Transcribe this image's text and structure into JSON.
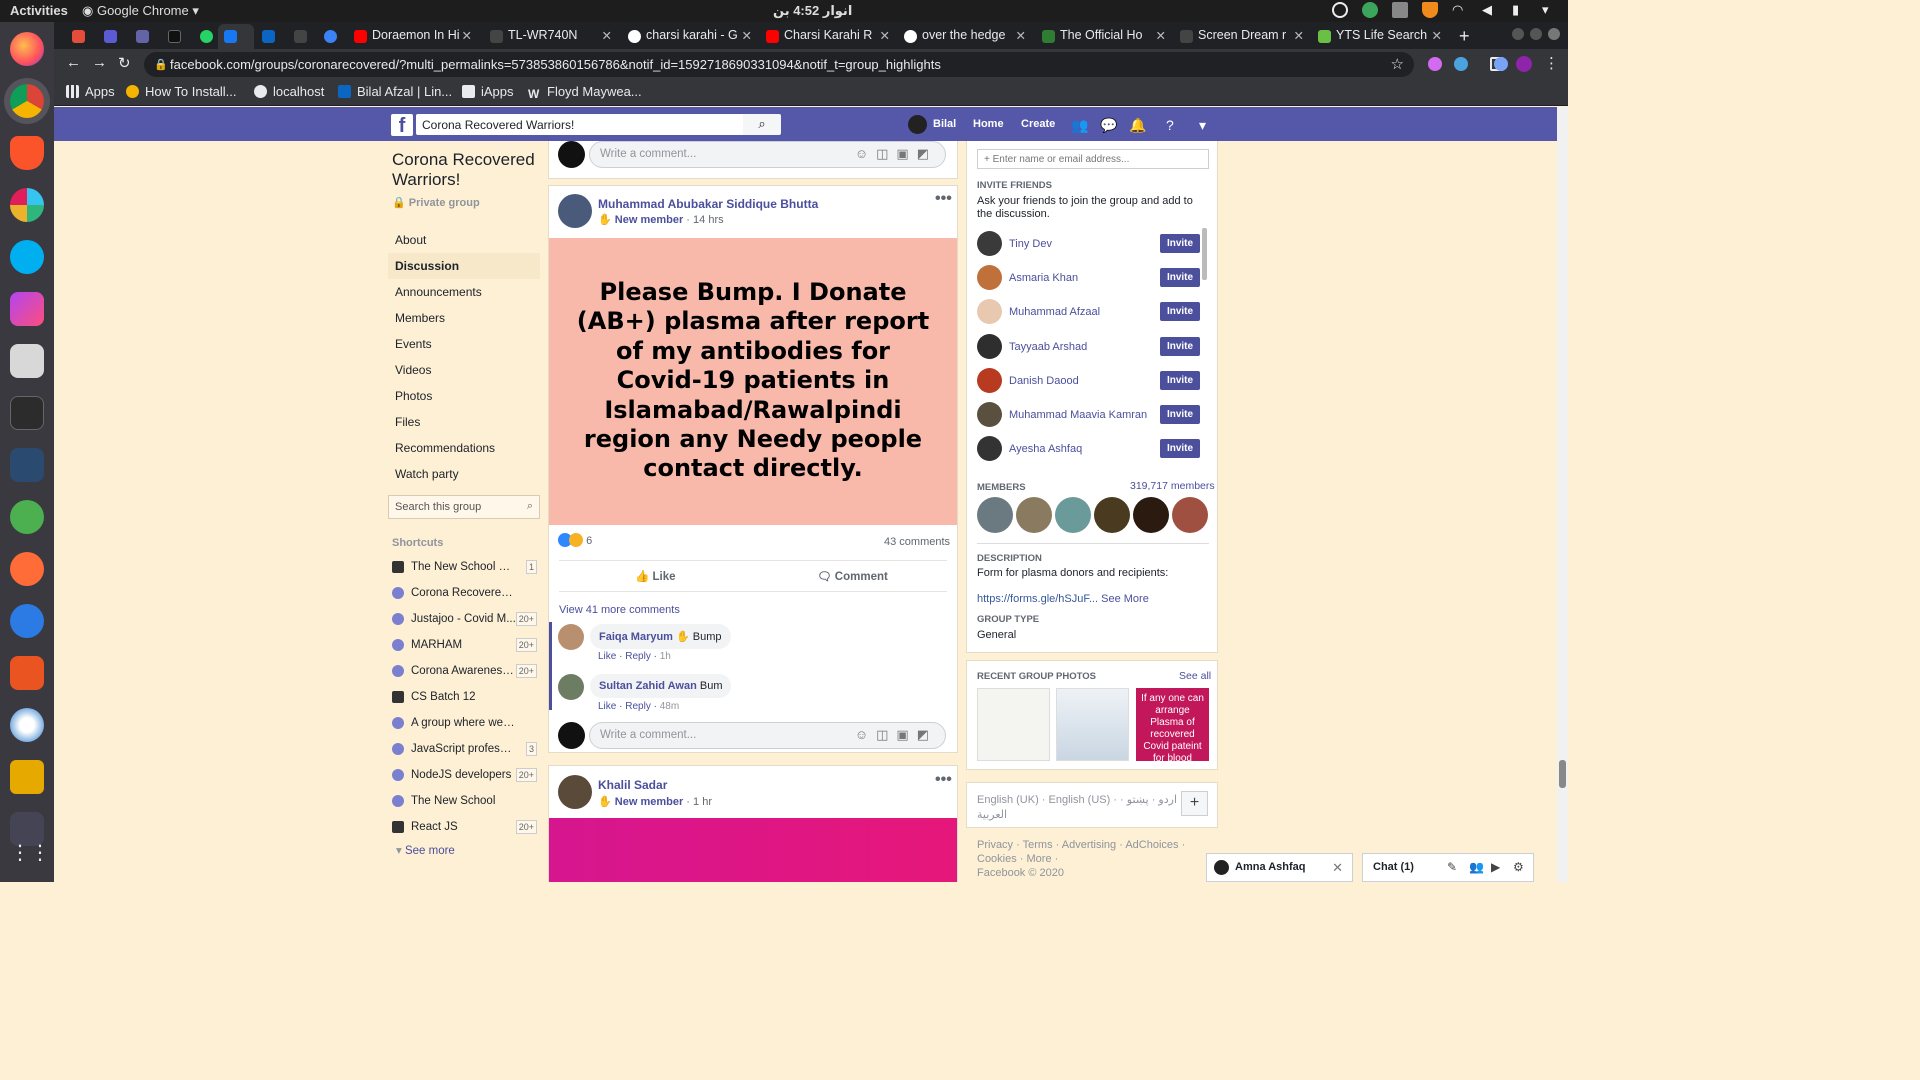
{
  "os": {
    "activities": "Activities",
    "app_menu": "Google Chrome",
    "clock": "انوار 4:52 بن"
  },
  "tabs": [
    {
      "label": "",
      "icon": "gmail-icon",
      "color": "#e44d3a"
    },
    {
      "label": "",
      "icon": "linear-icon",
      "color": "#5b5bd6"
    },
    {
      "label": "",
      "icon": "teams-icon",
      "color": "#6264a7"
    },
    {
      "label": "",
      "icon": "dev-icon",
      "color": "#111111"
    },
    {
      "label": "",
      "icon": "whatsapp-icon",
      "color": "#25d366"
    },
    {
      "label": "",
      "icon": "facebook-icon",
      "color": "#1877f2"
    },
    {
      "label": "",
      "icon": "linkedin-icon",
      "color": "#0a66c2"
    },
    {
      "label": "",
      "icon": "blank-icon",
      "color": "#444444"
    },
    {
      "label": "",
      "icon": "globe-icon",
      "color": "#3b82f6"
    },
    {
      "label": "Doraemon In Hi",
      "icon": "youtube-icon",
      "color": "#ff0000"
    },
    {
      "label": "TL-WR740N",
      "icon": "blank-icon",
      "color": "#444444"
    },
    {
      "label": "charsi karahi - G",
      "icon": "google-icon",
      "color": "#ffffff"
    },
    {
      "label": "Charsi Karahi R",
      "icon": "youtube-icon",
      "color": "#ff0000"
    },
    {
      "label": "over the hedge",
      "icon": "google-icon",
      "color": "#ffffff"
    },
    {
      "label": "The Official Ho",
      "icon": "leaf-icon",
      "color": "#2e7d32"
    },
    {
      "label": "Screen Dream r",
      "icon": "blank-icon",
      "color": "#444444"
    },
    {
      "label": "YTS Life Search",
      "icon": "yts-icon",
      "color": "#6ac045"
    }
  ],
  "browser": {
    "url": "facebook.com/groups/coronarecovered/?multi_permalinks=573853860156786&notif_id=1592718690331094&notif_t=group_highlights"
  },
  "bookmarks": [
    {
      "label": "Apps",
      "icon": "apps-grid-icon",
      "color": "#e8eaed"
    },
    {
      "label": "How To Install...",
      "icon": "howto-icon",
      "color": "#f4b400"
    },
    {
      "label": "localhost",
      "icon": "globe-icon",
      "color": "#e8eaed"
    },
    {
      "label": "Bilal Afzal | Lin...",
      "icon": "linkedin-icon",
      "color": "#0a66c2"
    },
    {
      "label": "iApps",
      "icon": "iapps-icon",
      "color": "#e8eaed"
    },
    {
      "label": "Floyd Maywea...",
      "icon": "wikipedia-icon",
      "color": "#e8eaed"
    }
  ],
  "fb_header": {
    "search_value": "Corona Recovered Warriors!",
    "user_name": "Bilal",
    "home": "Home",
    "create": "Create"
  },
  "left_nav": {
    "group_name": "Corona Recovered Warriors!",
    "privacy": "Private group",
    "items": [
      "About",
      "Discussion",
      "Announcements",
      "Members",
      "Events",
      "Videos",
      "Photos",
      "Files",
      "Recommendations",
      "Watch party"
    ],
    "active_index": 1,
    "search_placeholder": "Search this group",
    "shortcuts_heading": "Shortcuts",
    "shortcuts": [
      {
        "label": "The New School Lah...",
        "count": "1"
      },
      {
        "label": "Corona Recovered War...",
        "count": ""
      },
      {
        "label": "Justajoo - Covid M...",
        "count": "20+"
      },
      {
        "label": "MARHAM",
        "count": "20+"
      },
      {
        "label": "Corona Awareness...",
        "count": "20+"
      },
      {
        "label": "CS Batch 12",
        "count": ""
      },
      {
        "label": "A group where we all pr...",
        "count": ""
      },
      {
        "label": "JavaScript professio...",
        "count": "3"
      },
      {
        "label": "NodeJS developers",
        "count": "20+"
      },
      {
        "label": "The New School",
        "count": ""
      },
      {
        "label": "React JS",
        "count": "20+"
      }
    ],
    "see_more": "See more"
  },
  "feed": {
    "comment_placeholder": "Write a comment...",
    "post1": {
      "author": "Muhammad Abubakar Siddique Bhutta",
      "badge": "New member",
      "time": "14 hrs",
      "text": "Please Bump. I Donate (AB+) plasma after report of my antibodies for Covid-19 patients in Islamabad/Rawalpindi region any Needy people contact directly.",
      "bg_color": "#f8b9ab",
      "reaction_count": "6",
      "comments_count": "43 comments",
      "like_label": "Like",
      "comment_label": "Comment",
      "view_more": "View 41 more comments",
      "comments": [
        {
          "author": "Faiqa Maryum",
          "text": "Bump",
          "like": "Like",
          "reply": "Reply",
          "time": "1h"
        },
        {
          "author": "Sultan Zahid Awan",
          "text": "Bum",
          "like": "Like",
          "reply": "Reply",
          "time": "48m"
        }
      ]
    },
    "post2": {
      "author": "Khalil Sadar",
      "badge": "New member",
      "time": "1 hr"
    }
  },
  "right": {
    "invite_placeholder": "Enter name or email address...",
    "invite_heading": "INVITE FRIENDS",
    "invite_text": "Ask your friends to join the group and add to the discussion.",
    "invite_label": "Invite",
    "friends": [
      "Tiny Dev",
      "Asmaria Khan",
      "Muhammad Afzaal",
      "Tayyaab Arshad",
      "Danish Daood",
      "Muhammad Maavia Kamran",
      "Ayesha Ashfaq"
    ],
    "members_heading": "MEMBERS",
    "members_count": "319,717 members",
    "description_heading": "DESCRIPTION",
    "description": "Form for plasma donors and recipients:",
    "description_link": "https://forms.gle/hSJuF...",
    "see_more": "See More",
    "group_type_heading": "GROUP TYPE",
    "group_type": "General",
    "photos_heading": "RECENT GROUP PHOTOS",
    "see_all": "See all",
    "photo3_text": "If any one can arrange Plasma of recovered Covid pateint for blood"
  },
  "footer": {
    "languages": "English (UK) · English (US) · اردو · پښتو · العربية",
    "links": "Privacy · Terms · Advertising · AdChoices · Cookies · More ·",
    "copyright": "Facebook © 2020"
  },
  "chat": {
    "conversation": "Amna Ashfaq",
    "chat_label": "Chat (1)"
  }
}
